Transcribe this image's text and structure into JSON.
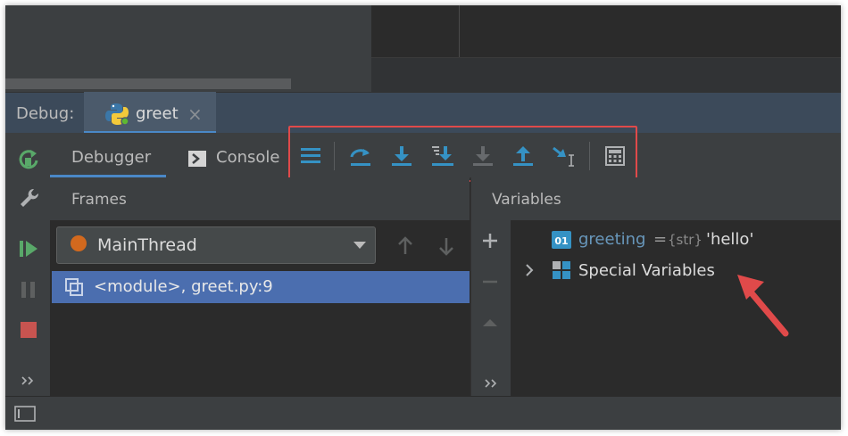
{
  "debug_bar": {
    "label": "Debug:",
    "tab_title": "greet",
    "close_glyph": "×"
  },
  "tabs": [
    {
      "label": "Debugger"
    },
    {
      "label": "Console"
    }
  ],
  "toolbar_icons": [
    "show-execution-point-icon",
    "step-over-icon",
    "step-into-icon",
    "step-into-my-code-icon",
    "force-step-into-icon",
    "step-out-icon",
    "run-to-cursor-icon",
    "evaluate-expression-icon"
  ],
  "frames": {
    "title": "Frames",
    "thread": "MainThread",
    "rows": [
      "<module>, greet.py:9"
    ]
  },
  "variables": {
    "title": "Variables",
    "items": [
      {
        "name": "greeting",
        "eq": "=",
        "type": "{str}",
        "value": "'hello'"
      },
      {
        "name": "Special Variables"
      }
    ]
  },
  "colors": {
    "accent": "#4a88c7",
    "selection": "#4b6eaf",
    "highlight_box": "#e04a4a",
    "annotation_arrow": "#e04a4a"
  }
}
